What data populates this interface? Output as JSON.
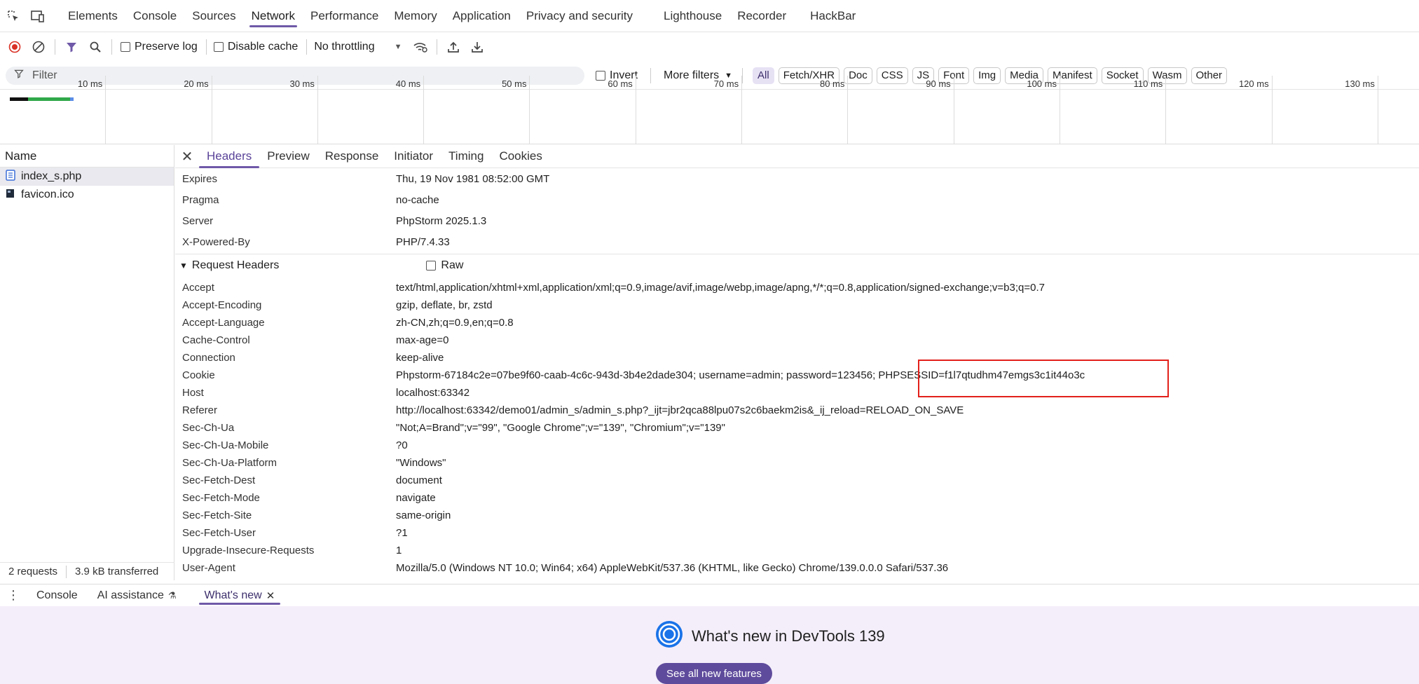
{
  "tabs": [
    "Elements",
    "Console",
    "Sources",
    "Network",
    "Performance",
    "Memory",
    "Application",
    "Privacy and security",
    "Lighthouse",
    "Recorder",
    "HackBar"
  ],
  "active_tab": "Network",
  "toolbar": {
    "preserve_log": "Preserve log",
    "disable_cache": "Disable cache",
    "throttling": "No throttling"
  },
  "filter": {
    "placeholder": "Filter",
    "invert": "Invert",
    "more_filters": "More filters",
    "chips": [
      "All",
      "Fetch/XHR",
      "Doc",
      "CSS",
      "JS",
      "Font",
      "Img",
      "Media",
      "Manifest",
      "Socket",
      "Wasm",
      "Other"
    ]
  },
  "timeline": {
    "labels": [
      "10 ms",
      "20 ms",
      "30 ms",
      "40 ms",
      "50 ms",
      "60 ms",
      "70 ms",
      "80 ms",
      "90 ms",
      "100 ms",
      "110 ms",
      "120 ms",
      "130 ms"
    ]
  },
  "requests": {
    "header": "Name",
    "items": [
      {
        "name": "index_s.php"
      },
      {
        "name": "favicon.ico"
      }
    ],
    "count": "2 requests",
    "transferred": "3.9 kB transferred"
  },
  "detail_tabs": [
    "Headers",
    "Preview",
    "Response",
    "Initiator",
    "Timing",
    "Cookies"
  ],
  "response_headers": [
    {
      "k": "Expires",
      "v": "Thu, 19 Nov 1981 08:52:00 GMT"
    },
    {
      "k": "Pragma",
      "v": "no-cache"
    },
    {
      "k": "Server",
      "v": "PhpStorm 2025.1.3"
    },
    {
      "k": "X-Powered-By",
      "v": "PHP/7.4.33"
    }
  ],
  "request_section": {
    "title": "Request Headers",
    "raw": "Raw"
  },
  "request_headers": [
    {
      "k": "Accept",
      "v": "text/html,application/xhtml+xml,application/xml;q=0.9,image/avif,image/webp,image/apng,*/*;q=0.8,application/signed-exchange;v=b3;q=0.7"
    },
    {
      "k": "Accept-Encoding",
      "v": "gzip, deflate, br, zstd"
    },
    {
      "k": "Accept-Language",
      "v": "zh-CN,zh;q=0.9,en;q=0.8"
    },
    {
      "k": "Cache-Control",
      "v": "max-age=0"
    },
    {
      "k": "Connection",
      "v": "keep-alive"
    },
    {
      "k": "Cookie",
      "v": "Phpstorm-67184c2e=07be9f60-caab-4c6c-943d-3b4e2dade304; username=admin; password=123456; PHPSESSID=f1l7qtudhm47emgs3c1it44o3c"
    },
    {
      "k": "Host",
      "v": "localhost:63342"
    },
    {
      "k": "Referer",
      "v": "http://localhost:63342/demo01/admin_s/admin_s.php?_ijt=jbr2qca88lpu07s2c6baekm2is&_ij_reload=RELOAD_ON_SAVE"
    },
    {
      "k": "Sec-Ch-Ua",
      "v": "\"Not;A=Brand\";v=\"99\", \"Google Chrome\";v=\"139\", \"Chromium\";v=\"139\""
    },
    {
      "k": "Sec-Ch-Ua-Mobile",
      "v": "?0"
    },
    {
      "k": "Sec-Ch-Ua-Platform",
      "v": "\"Windows\""
    },
    {
      "k": "Sec-Fetch-Dest",
      "v": "document"
    },
    {
      "k": "Sec-Fetch-Mode",
      "v": "navigate"
    },
    {
      "k": "Sec-Fetch-Site",
      "v": "same-origin"
    },
    {
      "k": "Sec-Fetch-User",
      "v": "?1"
    },
    {
      "k": "Upgrade-Insecure-Requests",
      "v": "1"
    },
    {
      "k": "User-Agent",
      "v": "Mozilla/5.0 (Windows NT 10.0; Win64; x64) AppleWebKit/537.36 (KHTML, like Gecko) Chrome/139.0.0.0 Safari/537.36"
    }
  ],
  "drawer": {
    "tabs": [
      "Console",
      "AI assistance",
      "What's new"
    ],
    "active": "What's new",
    "title": "What's new in DevTools 139",
    "button": "See all new features"
  },
  "colors": {
    "accent": "#6f59a8",
    "record_red": "#d93025",
    "highlight": "#e3201b",
    "drawer_bg": "#f4eefa"
  }
}
